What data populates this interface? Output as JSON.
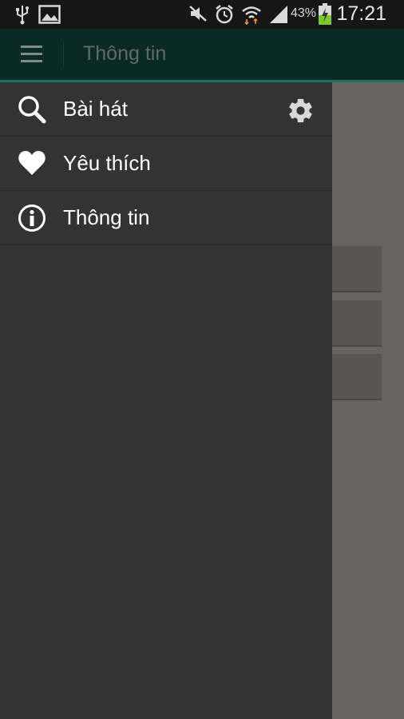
{
  "status_bar": {
    "icons": [
      "usb-icon",
      "gallery-icon",
      "mute-icon",
      "alarm-icon",
      "wifi-icon",
      "signal-icon",
      "battery-charging-icon"
    ],
    "battery_percent": "43%",
    "time": "17:21"
  },
  "action_bar": {
    "title": "Thông tin",
    "menu_icon": "hamburger-menu-icon",
    "background_color": "#0a2a28",
    "accent_color": "#1f6e68"
  },
  "drawer": {
    "items": [
      {
        "label": "Bài hát",
        "icon": "search-icon"
      },
      {
        "label": "Yêu thích",
        "icon": "heart-icon"
      },
      {
        "label": "Thông tin",
        "icon": "info-icon"
      }
    ],
    "settings_icon": "gear-icon",
    "background_color": "#333333"
  }
}
